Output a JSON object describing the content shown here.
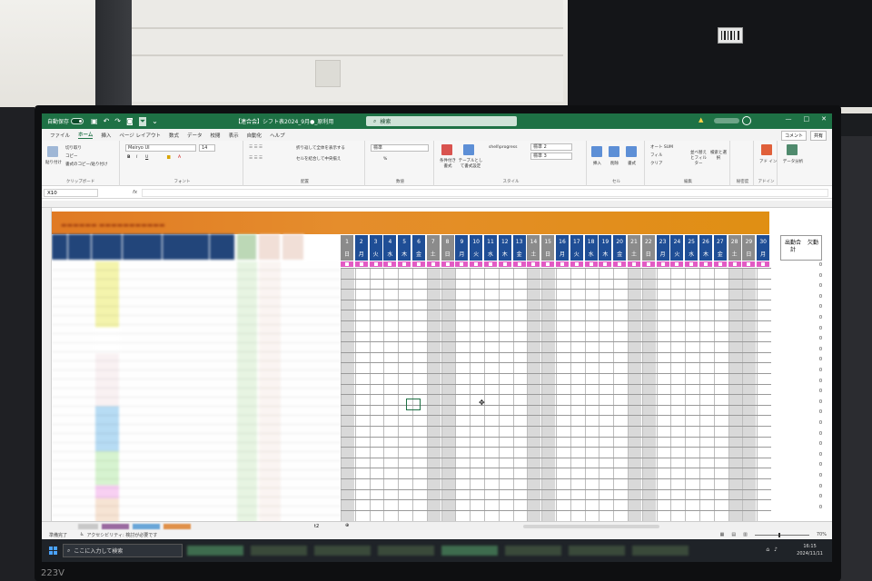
{
  "monitor": {
    "model": "223V"
  },
  "titlebar": {
    "autosave_label": "自動保存",
    "autosave_state": "オフ",
    "doc_title": "【連合会】シフト表2024_9月●_原利用",
    "search_placeholder": "検索",
    "window_controls": [
      "—",
      "□",
      "✕"
    ]
  },
  "ribbon_tabs": [
    "ファイル",
    "ホーム",
    "挿入",
    "ページ レイアウト",
    "数式",
    "データ",
    "校閲",
    "表示",
    "自動化",
    "ヘルプ"
  ],
  "ribbon_buttons": {
    "comment": "コメント",
    "share": "共有"
  },
  "ribbon": {
    "clipboard": {
      "label": "クリップボード",
      "cut": "切り取り",
      "copy": "コピー",
      "format_painter": "書式のコピー/貼り付け",
      "paste": "貼り付け"
    },
    "font": {
      "label": "フォント",
      "name": "Meiryo UI",
      "size": "14",
      "bold": "B",
      "italic": "I",
      "underline": "U"
    },
    "alignment": {
      "label": "配置",
      "wrap": "折り返して全体を表示する",
      "merge": "セルを結合して中央揃え"
    },
    "number": {
      "label": "数値",
      "format": "標準",
      "percent": "%"
    },
    "styles": {
      "label": "スタイル",
      "cond": "条件付き書式",
      "table": "テーブルとして書式設定",
      "style_name": "shell\\progress",
      "s1": "標準 2",
      "s2": "標準 3"
    },
    "cells": {
      "label": "セル",
      "insert": "挿入",
      "delete": "削除",
      "format": "書式"
    },
    "editing": {
      "label": "編集",
      "autosum": "オート SUM",
      "fill": "フィル",
      "clear": "クリア",
      "sort": "並べ替えとフィルター",
      "find": "検索と選択"
    },
    "extra": {
      "sensitivity": "秘密度",
      "addins": "アドイン",
      "addin_short": "アド イン",
      "analyze": "データ分析"
    }
  },
  "formula_bar": {
    "name_box": "X10",
    "fx": "fx"
  },
  "days": [
    {
      "d": "1",
      "w": "日"
    },
    {
      "d": "2",
      "w": "月"
    },
    {
      "d": "3",
      "w": "火"
    },
    {
      "d": "4",
      "w": "水"
    },
    {
      "d": "5",
      "w": "木"
    },
    {
      "d": "6",
      "w": "金"
    },
    {
      "d": "7",
      "w": "土"
    },
    {
      "d": "8",
      "w": "日"
    },
    {
      "d": "9",
      "w": "月"
    },
    {
      "d": "10",
      "w": "火"
    },
    {
      "d": "11",
      "w": "水"
    },
    {
      "d": "12",
      "w": "木"
    },
    {
      "d": "13",
      "w": "金"
    },
    {
      "d": "14",
      "w": "土"
    },
    {
      "d": "15",
      "w": "日"
    },
    {
      "d": "16",
      "w": "月"
    },
    {
      "d": "17",
      "w": "火"
    },
    {
      "d": "18",
      "w": "水"
    },
    {
      "d": "19",
      "w": "木"
    },
    {
      "d": "20",
      "w": "金"
    },
    {
      "d": "21",
      "w": "土"
    },
    {
      "d": "22",
      "w": "日"
    },
    {
      "d": "23",
      "w": "月"
    },
    {
      "d": "24",
      "w": "火"
    },
    {
      "d": "25",
      "w": "水"
    },
    {
      "d": "26",
      "w": "木"
    },
    {
      "d": "27",
      "w": "金"
    },
    {
      "d": "28",
      "w": "土"
    },
    {
      "d": "29",
      "w": "日"
    },
    {
      "d": "30",
      "w": "月"
    }
  ],
  "totals": {
    "attend": "出勤合計",
    "absent": "欠勤",
    "zero": "0"
  },
  "sheet_tab_label": "t2",
  "status": {
    "ready": "準備完了",
    "accessibility": "アクセシビリティ: 検討が必要です",
    "zoom": "70%"
  },
  "taskbar": {
    "search_placeholder": "ここに入力して検索",
    "time": "16:15",
    "date": "2024/11/11"
  }
}
